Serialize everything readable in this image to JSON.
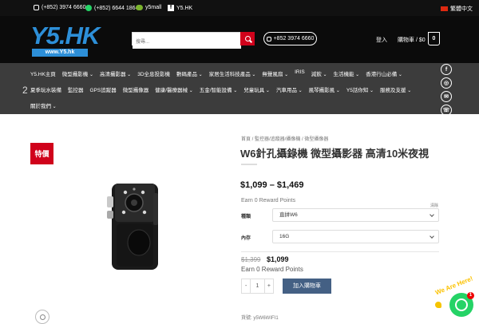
{
  "topbar": {
    "phone1": "(+852) 3974 6660",
    "whatsapp": "(+852) 6644 1864",
    "wechat": "y5mall",
    "facebook": "Y5.HK",
    "language": "繁體中文"
  },
  "header": {
    "logo_text": "Y5.HK",
    "logo_url_text": "www.Y5.hk",
    "search_placeholder": "搜尋...",
    "phone_button": "+852 3974 6660",
    "login": "登入",
    "cart_label": "購物車 / $0",
    "cart_count": "0"
  },
  "nav": {
    "row1": [
      "Y5.HK主頁",
      "微型攝影機",
      "高清攝影器",
      "3D全息投影機",
      "數碼產品",
      "家居生活科技產品",
      "無聲風扇",
      "IRIS",
      "減飲",
      "生活機能",
      "香港行山必備"
    ],
    "row1_dropdown": [
      false,
      true,
      true,
      false,
      true,
      true,
      true,
      false,
      true,
      true,
      true
    ],
    "row2": [
      "夏季玩水裝備",
      "監控器",
      "GPS追蹤器",
      "微型攝像器",
      "健康/醫療器械",
      "五金/智能設備",
      "兒童玩具",
      "汽車用品",
      "風琴攝影風",
      "Y5話你知",
      "服務及支援"
    ],
    "row2_dropdown": [
      false,
      false,
      false,
      false,
      true,
      true,
      true,
      true,
      true,
      true,
      true
    ],
    "row3": [
      "關於我們"
    ],
    "row3_dropdown": [
      true
    ],
    "side_number": "2",
    "social_icons": [
      "facebook-icon",
      "instagram-icon",
      "email-icon",
      "phone-icon"
    ]
  },
  "product": {
    "sale_badge": "特價",
    "breadcrumb": "首頁 / 監控器/追蹤器/攝像機 / 微型攝像器",
    "title": "W6針孔攝錄機 微型攝影器 高清10米夜視",
    "price_range": "$1,099 – $1,469",
    "reward_text": "Earn 0 Reward Points",
    "clear_link": "清除",
    "option1_label": "種類",
    "option1_value": "直拼W6",
    "option2_label": "內存",
    "option2_value": "16G",
    "old_price": "$1,399",
    "new_price": "$1,099",
    "reward_text2": "Earn 0 Reward Points",
    "qty_minus": "-",
    "qty_value": "1",
    "qty_plus": "+",
    "add_to_cart": "加入購物車",
    "sku": "貨號: y5W6WIFI1"
  },
  "chat": {
    "tagline": "We Are Here!",
    "badge_count": "1"
  },
  "colors": {
    "header_bg": "#0b0b0b",
    "nav_bg": "#3c3c3c",
    "brand_blue": "#2d8fd8",
    "sale_red": "#d0021b",
    "button_blue": "#446084",
    "whatsapp_green": "#25d366"
  }
}
